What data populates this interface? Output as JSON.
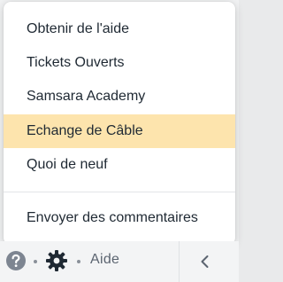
{
  "menu": {
    "items": [
      {
        "label": "Obtenir de l'aide"
      },
      {
        "label": "Tickets Ouverts"
      },
      {
        "label": "Samsara Academy"
      },
      {
        "label": "Echange de Câble",
        "highlighted": true
      },
      {
        "label": "Quoi de neuf"
      },
      {
        "label": "Envoyer des commentaires"
      }
    ]
  },
  "footer": {
    "icons": [
      "help-circle-icon",
      "gear-icon",
      "chevron-left-icon"
    ],
    "help_label": "Aide"
  },
  "colors": {
    "highlight": "#fde4ad",
    "text": "#1f2933",
    "muted": "#5b6470"
  }
}
